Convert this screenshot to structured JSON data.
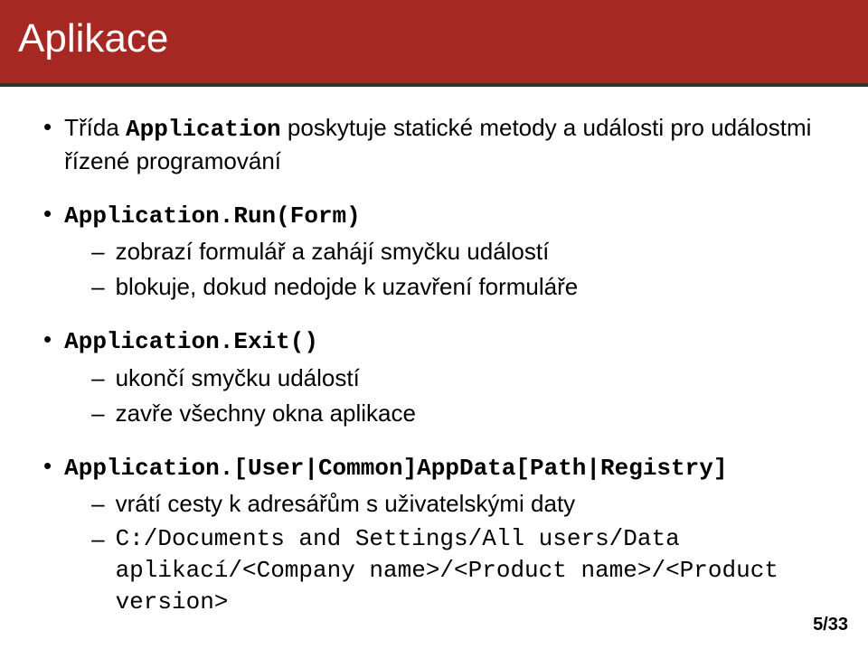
{
  "header": {
    "title": "Aplikace"
  },
  "items": [
    {
      "lead_pre": "Třída ",
      "lead_mono": "Application",
      "lead_post": " poskytuje statické metody a události pro událostmi řízené programování",
      "subs": []
    },
    {
      "lead_pre": "",
      "lead_mono": "Application.Run(Form)",
      "lead_post": "",
      "subs": [
        {
          "text": "zobrazí formulář a zahájí smyčku událostí",
          "mono": false
        },
        {
          "text": "blokuje, dokud nedojde k uzavření formuláře",
          "mono": false
        }
      ]
    },
    {
      "lead_pre": "",
      "lead_mono": "Application.Exit()",
      "lead_post": "",
      "subs": [
        {
          "text": "ukončí smyčku událostí",
          "mono": false
        },
        {
          "text": "zavře všechny okna aplikace",
          "mono": false
        }
      ]
    },
    {
      "lead_pre": "",
      "lead_mono": "Application.[User|Common]AppData[Path|Registry]",
      "lead_post": "",
      "subs": [
        {
          "text": "vrátí cesty k adresářům s uživatelskými daty",
          "mono": false
        },
        {
          "text": "C:/Documents and Settings/All users/Data aplikací/<Company name>/<Product name>/<Product version>",
          "mono": true
        }
      ]
    }
  ],
  "page_number": "5/33"
}
